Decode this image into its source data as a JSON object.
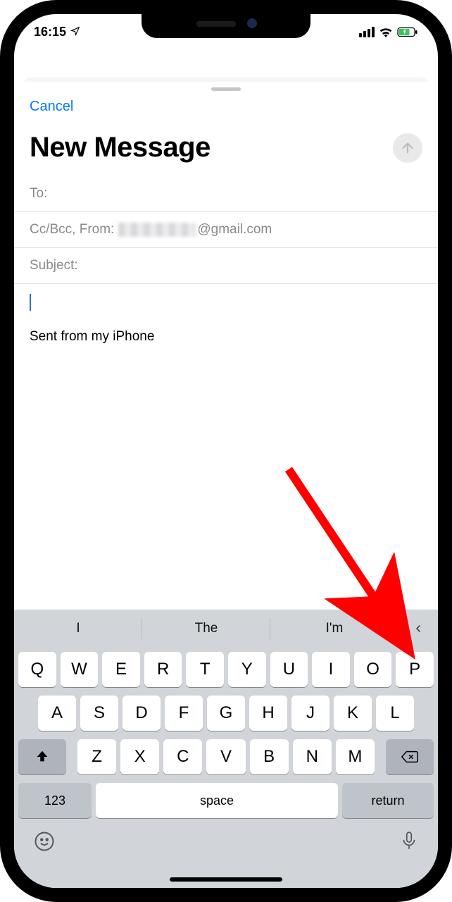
{
  "status": {
    "time": "16:15"
  },
  "header": {
    "cancel": "Cancel",
    "title": "New Message"
  },
  "fields": {
    "to_label": "To:",
    "ccbcc_label": "Cc/Bcc, From:",
    "from_domain": "@gmail.com",
    "subject_label": "Subject:"
  },
  "body": {
    "signature": "Sent from my iPhone"
  },
  "keyboard": {
    "suggestions": [
      "I",
      "The",
      "I'm"
    ],
    "row1": [
      "Q",
      "W",
      "E",
      "R",
      "T",
      "Y",
      "U",
      "I",
      "O",
      "P"
    ],
    "row2": [
      "A",
      "S",
      "D",
      "F",
      "G",
      "H",
      "J",
      "K",
      "L"
    ],
    "row3": [
      "Z",
      "X",
      "C",
      "V",
      "B",
      "N",
      "M"
    ],
    "num_key": "123",
    "space_key": "space",
    "return_key": "return"
  }
}
